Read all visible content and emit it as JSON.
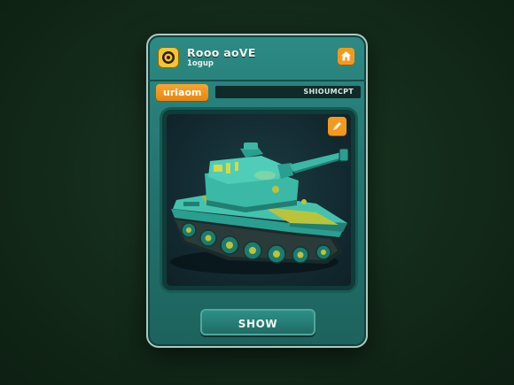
{
  "header": {
    "title": "Rooo aoVE",
    "subtitle": "1ogup",
    "logo_icon": "gold-coin-icon",
    "home_icon": "home-icon"
  },
  "info": {
    "tag_label": "uriaom",
    "status_text": "SHIOUMCPT"
  },
  "viewport": {
    "action_icon": "pen-icon",
    "subject": "tank"
  },
  "actions": {
    "show_label": "SHOW"
  },
  "colors": {
    "card": "#23756f",
    "accent_orange": "#f39a1e",
    "tank_body": "#3cb8a6",
    "tank_trim": "#b9c43a",
    "background": "#132a1a"
  }
}
